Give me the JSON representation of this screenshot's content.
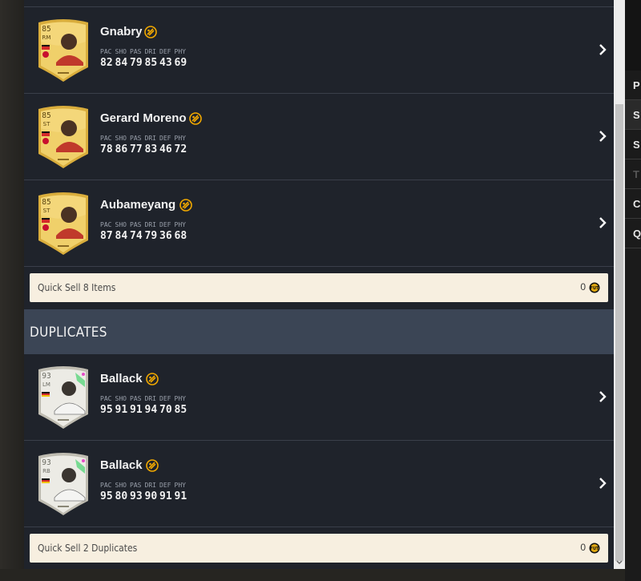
{
  "players": [
    {
      "name": "Gnabry",
      "rating": "85",
      "position": "RM",
      "card": "gold",
      "stat_labels": [
        "PAC",
        "SHO",
        "PAS",
        "DRI",
        "DEF",
        "PHY"
      ],
      "stats": [
        "82",
        "84",
        "79",
        "85",
        "43",
        "69"
      ]
    },
    {
      "name": "Gerard Moreno",
      "rating": "85",
      "position": "ST",
      "card": "gold",
      "stat_labels": [
        "PAC",
        "SHO",
        "PAS",
        "DRI",
        "DEF",
        "PHY"
      ],
      "stats": [
        "78",
        "86",
        "77",
        "83",
        "46",
        "72"
      ]
    },
    {
      "name": "Aubameyang",
      "rating": "85",
      "position": "ST",
      "card": "gold",
      "stat_labels": [
        "PAC",
        "SHO",
        "PAS",
        "DRI",
        "DEF",
        "PHY"
      ],
      "stats": [
        "87",
        "84",
        "74",
        "79",
        "36",
        "68"
      ]
    }
  ],
  "quick_sell_items": {
    "label": "Quick Sell 8 Items",
    "value": "0"
  },
  "duplicates": {
    "title": "DUPLICATES",
    "players": [
      {
        "name": "Ballack",
        "rating": "93",
        "position": "LM",
        "card": "icon",
        "stat_labels": [
          "PAC",
          "SHO",
          "PAS",
          "DRI",
          "DEF",
          "PHY"
        ],
        "stats": [
          "95",
          "91",
          "91",
          "94",
          "70",
          "85"
        ]
      },
      {
        "name": "Ballack",
        "rating": "93",
        "position": "RB",
        "card": "icon",
        "stat_labels": [
          "PAC",
          "SHO",
          "PAS",
          "DRI",
          "DEF",
          "PHY"
        ],
        "stats": [
          "95",
          "80",
          "93",
          "90",
          "91",
          "91"
        ]
      }
    ],
    "quick_sell": {
      "label": "Quick Sell 2 Duplicates",
      "value": "0"
    }
  },
  "side_menu": [
    {
      "label": "P",
      "enabled": true
    },
    {
      "label": "S",
      "enabled": true
    },
    {
      "label": "S",
      "enabled": true
    },
    {
      "label": "T",
      "enabled": false
    },
    {
      "label": "C",
      "enabled": true
    },
    {
      "label": "Q",
      "enabled": true
    }
  ],
  "colors": {
    "panel_bg": "#1f232b",
    "section_header_bg": "#3b4555",
    "quick_sell_bg": "#f7efe0",
    "chem_icon": "#f2a900",
    "gold_card": "#e9c44f",
    "icon_card": "#e6e4dc"
  },
  "icons": {
    "chemistry": "chemistry-style-icon",
    "coin": "coin-icon",
    "chevron": "chevron-right-icon"
  }
}
